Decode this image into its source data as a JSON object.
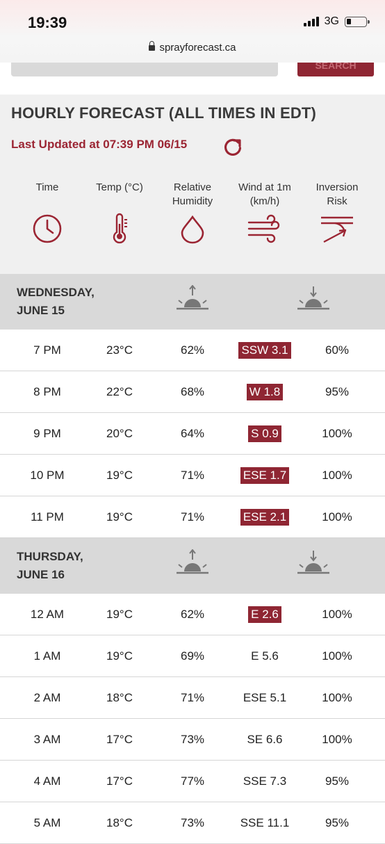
{
  "status": {
    "time": "19:39",
    "network": "3G",
    "url": "sprayforecast.ca"
  },
  "search": {
    "button_label": "SEARCH"
  },
  "forecast": {
    "title": "HOURLY FORECAST (ALL TIMES IN EDT)",
    "last_updated": "Last Updated at 07:39 PM 06/15",
    "columns": [
      "Time",
      "Temp (°C)",
      "Relative Humidity",
      "Wind at 1m (km/h)",
      "Inversion Risk"
    ],
    "column_lines": [
      [
        "Time"
      ],
      [
        "Temp (°C)"
      ],
      [
        "Relative",
        "Humidity"
      ],
      [
        "Wind at 1m",
        "(km/h)"
      ],
      [
        "Inversion",
        "Risk"
      ]
    ],
    "column_icons": [
      "clock-icon",
      "thermometer-icon",
      "droplet-icon",
      "wind-icon",
      "inversion-icon"
    ],
    "accent_color": "#8f2633",
    "days": [
      {
        "label_line1": "WEDNESDAY,",
        "label_line2": "JUNE 15",
        "rows": [
          {
            "time": "7 PM",
            "temp": "23°C",
            "humidity": "62%",
            "wind": "SSW 3.1",
            "wind_highlight": true,
            "inversion": "60%"
          },
          {
            "time": "8 PM",
            "temp": "22°C",
            "humidity": "68%",
            "wind": "W 1.8",
            "wind_highlight": true,
            "inversion": "95%"
          },
          {
            "time": "9 PM",
            "temp": "20°C",
            "humidity": "64%",
            "wind": "S 0.9",
            "wind_highlight": true,
            "inversion": "100%"
          },
          {
            "time": "10 PM",
            "temp": "19°C",
            "humidity": "71%",
            "wind": "ESE 1.7",
            "wind_highlight": true,
            "inversion": "100%"
          },
          {
            "time": "11 PM",
            "temp": "19°C",
            "humidity": "71%",
            "wind": "ESE 2.1",
            "wind_highlight": true,
            "inversion": "100%"
          }
        ]
      },
      {
        "label_line1": "THURSDAY,",
        "label_line2": "JUNE 16",
        "rows": [
          {
            "time": "12 AM",
            "temp": "19°C",
            "humidity": "62%",
            "wind": "E 2.6",
            "wind_highlight": true,
            "inversion": "100%"
          },
          {
            "time": "1 AM",
            "temp": "19°C",
            "humidity": "69%",
            "wind": "E 5.6",
            "wind_highlight": false,
            "inversion": "100%"
          },
          {
            "time": "2 AM",
            "temp": "18°C",
            "humidity": "71%",
            "wind": "ESE 5.1",
            "wind_highlight": false,
            "inversion": "100%"
          },
          {
            "time": "3 AM",
            "temp": "17°C",
            "humidity": "73%",
            "wind": "SE 6.6",
            "wind_highlight": false,
            "inversion": "100%"
          },
          {
            "time": "4 AM",
            "temp": "17°C",
            "humidity": "77%",
            "wind": "SSE 7.3",
            "wind_highlight": false,
            "inversion": "95%"
          },
          {
            "time": "5 AM",
            "temp": "18°C",
            "humidity": "73%",
            "wind": "SSE 11.1",
            "wind_highlight": false,
            "inversion": "95%"
          }
        ]
      }
    ]
  }
}
